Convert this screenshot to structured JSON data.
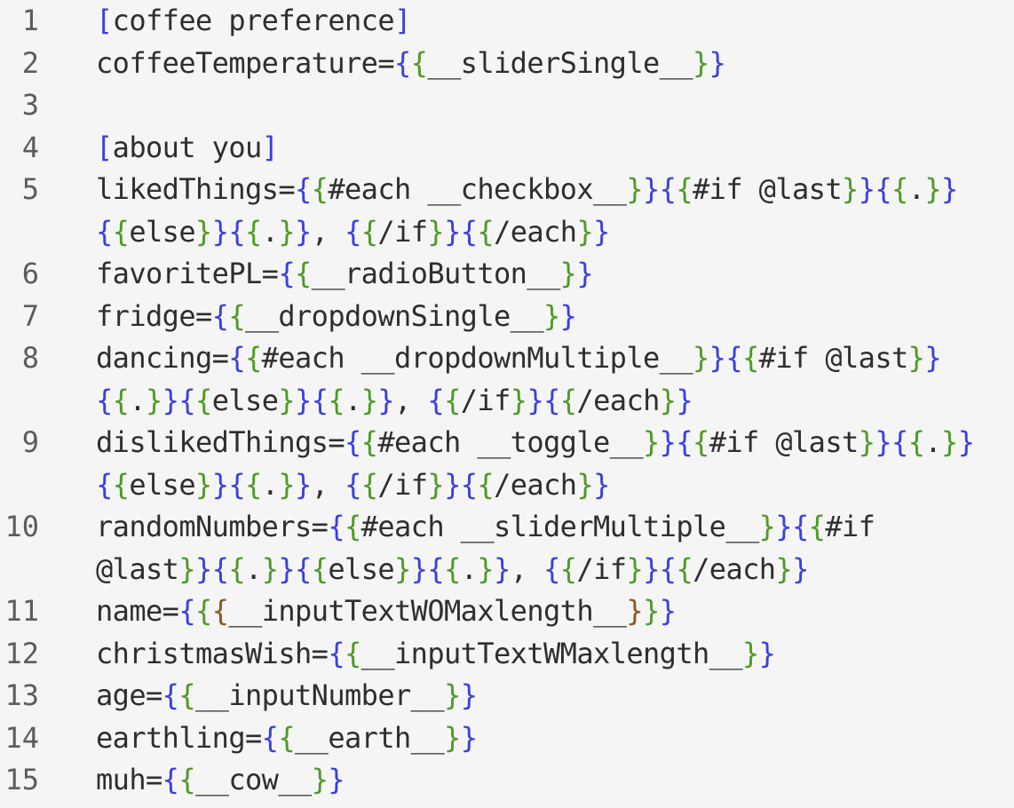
{
  "editor": {
    "line_numbers": [
      "1",
      "2",
      "3",
      "4",
      "5",
      "6",
      "7",
      "8",
      "9",
      "10",
      "11",
      "12",
      "13",
      "14",
      "15"
    ],
    "lines": [
      {
        "row": 0,
        "tokens": [
          [
            "sq",
            "["
          ],
          [
            "t",
            "coffee preference"
          ],
          [
            "sq",
            "]"
          ]
        ]
      },
      {
        "row": 1,
        "tokens": [
          [
            "t",
            "coffeeTemperature="
          ],
          [
            "b1",
            "{"
          ],
          [
            "b2",
            "{"
          ],
          [
            "t",
            "__sliderSingle__"
          ],
          [
            "b2",
            "}"
          ],
          [
            "b1",
            "}"
          ]
        ]
      },
      {
        "row": 2,
        "tokens": []
      },
      {
        "row": 3,
        "tokens": [
          [
            "sq",
            "["
          ],
          [
            "t",
            "about you"
          ],
          [
            "sq",
            "]"
          ]
        ]
      },
      {
        "row": 4,
        "tokens": [
          [
            "t",
            "likedThings="
          ],
          [
            "b1",
            "{"
          ],
          [
            "b2",
            "{"
          ],
          [
            "t",
            "#each __checkbox__"
          ],
          [
            "b2",
            "}"
          ],
          [
            "b1",
            "}"
          ],
          [
            "b1",
            "{"
          ],
          [
            "b2",
            "{"
          ],
          [
            "t",
            "#if @last"
          ],
          [
            "b2",
            "}"
          ],
          [
            "b1",
            "}"
          ],
          [
            "b1",
            "{"
          ],
          [
            "b2",
            "{"
          ],
          [
            "t",
            "."
          ],
          [
            "b2",
            "}"
          ],
          [
            "b1",
            "}"
          ]
        ]
      },
      {
        "row": 5,
        "tokens": [
          [
            "b1",
            "{"
          ],
          [
            "b2",
            "{"
          ],
          [
            "t",
            "else"
          ],
          [
            "b2",
            "}"
          ],
          [
            "b1",
            "}"
          ],
          [
            "b1",
            "{"
          ],
          [
            "b2",
            "{"
          ],
          [
            "t",
            "."
          ],
          [
            "b2",
            "}"
          ],
          [
            "b1",
            "}"
          ],
          [
            "t",
            ", "
          ],
          [
            "b1",
            "{"
          ],
          [
            "b2",
            "{"
          ],
          [
            "t",
            "/if"
          ],
          [
            "b2",
            "}"
          ],
          [
            "b1",
            "}"
          ],
          [
            "b1",
            "{"
          ],
          [
            "b2",
            "{"
          ],
          [
            "t",
            "/each"
          ],
          [
            "b2",
            "}"
          ],
          [
            "b1",
            "}"
          ]
        ]
      },
      {
        "row": 6,
        "tokens": [
          [
            "t",
            "favoritePL="
          ],
          [
            "b1",
            "{"
          ],
          [
            "b2",
            "{"
          ],
          [
            "t",
            "__radioButton__"
          ],
          [
            "b2",
            "}"
          ],
          [
            "b1",
            "}"
          ]
        ]
      },
      {
        "row": 7,
        "tokens": [
          [
            "t",
            "fridge="
          ],
          [
            "b1",
            "{"
          ],
          [
            "b2",
            "{"
          ],
          [
            "t",
            "__dropdownSingle__"
          ],
          [
            "b2",
            "}"
          ],
          [
            "b1",
            "}"
          ]
        ]
      },
      {
        "row": 8,
        "tokens": [
          [
            "t",
            "dancing="
          ],
          [
            "b1",
            "{"
          ],
          [
            "b2",
            "{"
          ],
          [
            "t",
            "#each __dropdownMultiple__"
          ],
          [
            "b2",
            "}"
          ],
          [
            "b1",
            "}"
          ],
          [
            "b1",
            "{"
          ],
          [
            "b2",
            "{"
          ],
          [
            "t",
            "#if @last"
          ],
          [
            "b2",
            "}"
          ],
          [
            "b1",
            "}"
          ]
        ]
      },
      {
        "row": 9,
        "tokens": [
          [
            "b1",
            "{"
          ],
          [
            "b2",
            "{"
          ],
          [
            "t",
            "."
          ],
          [
            "b2",
            "}"
          ],
          [
            "b1",
            "}"
          ],
          [
            "b1",
            "{"
          ],
          [
            "b2",
            "{"
          ],
          [
            "t",
            "else"
          ],
          [
            "b2",
            "}"
          ],
          [
            "b1",
            "}"
          ],
          [
            "b1",
            "{"
          ],
          [
            "b2",
            "{"
          ],
          [
            "t",
            "."
          ],
          [
            "b2",
            "}"
          ],
          [
            "b1",
            "}"
          ],
          [
            "t",
            ", "
          ],
          [
            "b1",
            "{"
          ],
          [
            "b2",
            "{"
          ],
          [
            "t",
            "/if"
          ],
          [
            "b2",
            "}"
          ],
          [
            "b1",
            "}"
          ],
          [
            "b1",
            "{"
          ],
          [
            "b2",
            "{"
          ],
          [
            "t",
            "/each"
          ],
          [
            "b2",
            "}"
          ],
          [
            "b1",
            "}"
          ]
        ]
      },
      {
        "row": 10,
        "tokens": [
          [
            "t",
            "dislikedThings="
          ],
          [
            "b1",
            "{"
          ],
          [
            "b2",
            "{"
          ],
          [
            "t",
            "#each __toggle__"
          ],
          [
            "b2",
            "}"
          ],
          [
            "b1",
            "}"
          ],
          [
            "b1",
            "{"
          ],
          [
            "b2",
            "{"
          ],
          [
            "t",
            "#if @last"
          ],
          [
            "b2",
            "}"
          ],
          [
            "b1",
            "}"
          ],
          [
            "b1",
            "{"
          ],
          [
            "b2",
            "{"
          ],
          [
            "t",
            "."
          ],
          [
            "b2",
            "}"
          ],
          [
            "b1",
            "}"
          ]
        ]
      },
      {
        "row": 11,
        "tokens": [
          [
            "b1",
            "{"
          ],
          [
            "b2",
            "{"
          ],
          [
            "t",
            "else"
          ],
          [
            "b2",
            "}"
          ],
          [
            "b1",
            "}"
          ],
          [
            "b1",
            "{"
          ],
          [
            "b2",
            "{"
          ],
          [
            "t",
            "."
          ],
          [
            "b2",
            "}"
          ],
          [
            "b1",
            "}"
          ],
          [
            "t",
            ", "
          ],
          [
            "b1",
            "{"
          ],
          [
            "b2",
            "{"
          ],
          [
            "t",
            "/if"
          ],
          [
            "b2",
            "}"
          ],
          [
            "b1",
            "}"
          ],
          [
            "b1",
            "{"
          ],
          [
            "b2",
            "{"
          ],
          [
            "t",
            "/each"
          ],
          [
            "b2",
            "}"
          ],
          [
            "b1",
            "}"
          ]
        ]
      },
      {
        "row": 12,
        "tokens": [
          [
            "t",
            "randomNumbers="
          ],
          [
            "b1",
            "{"
          ],
          [
            "b2",
            "{"
          ],
          [
            "t",
            "#each __sliderMultiple__"
          ],
          [
            "b2",
            "}"
          ],
          [
            "b1",
            "}"
          ],
          [
            "b1",
            "{"
          ],
          [
            "b2",
            "{"
          ],
          [
            "t",
            "#if"
          ]
        ]
      },
      {
        "row": 13,
        "tokens": [
          [
            "t",
            "@last"
          ],
          [
            "b2",
            "}"
          ],
          [
            "b1",
            "}"
          ],
          [
            "b1",
            "{"
          ],
          [
            "b2",
            "{"
          ],
          [
            "t",
            "."
          ],
          [
            "b2",
            "}"
          ],
          [
            "b1",
            "}"
          ],
          [
            "b1",
            "{"
          ],
          [
            "b2",
            "{"
          ],
          [
            "t",
            "else"
          ],
          [
            "b2",
            "}"
          ],
          [
            "b1",
            "}"
          ],
          [
            "b1",
            "{"
          ],
          [
            "b2",
            "{"
          ],
          [
            "t",
            "."
          ],
          [
            "b2",
            "}"
          ],
          [
            "b1",
            "}"
          ],
          [
            "t",
            ", "
          ],
          [
            "b1",
            "{"
          ],
          [
            "b2",
            "{"
          ],
          [
            "t",
            "/if"
          ],
          [
            "b2",
            "}"
          ],
          [
            "b1",
            "}"
          ],
          [
            "b1",
            "{"
          ],
          [
            "b2",
            "{"
          ],
          [
            "t",
            "/each"
          ],
          [
            "b2",
            "}"
          ],
          [
            "b1",
            "}"
          ]
        ]
      },
      {
        "row": 14,
        "tokens": [
          [
            "t",
            "name="
          ],
          [
            "b1",
            "{"
          ],
          [
            "b2",
            "{"
          ],
          [
            "b3",
            "{"
          ],
          [
            "t",
            "__inputTextWOMaxlength__"
          ],
          [
            "b3",
            "}"
          ],
          [
            "b2",
            "}"
          ],
          [
            "b1",
            "}"
          ]
        ]
      },
      {
        "row": 15,
        "tokens": [
          [
            "t",
            "christmasWish="
          ],
          [
            "b1",
            "{"
          ],
          [
            "b2",
            "{"
          ],
          [
            "t",
            "__inputTextWMaxlength__"
          ],
          [
            "b2",
            "}"
          ],
          [
            "b1",
            "}"
          ]
        ]
      },
      {
        "row": 16,
        "tokens": [
          [
            "t",
            "age="
          ],
          [
            "b1",
            "{"
          ],
          [
            "b2",
            "{"
          ],
          [
            "t",
            "__inputNumber__"
          ],
          [
            "b2",
            "}"
          ],
          [
            "b1",
            "}"
          ]
        ]
      },
      {
        "row": 17,
        "tokens": [
          [
            "t",
            "earthling="
          ],
          [
            "b1",
            "{"
          ],
          [
            "b2",
            "{"
          ],
          [
            "t",
            "__earth__"
          ],
          [
            "b2",
            "}"
          ],
          [
            "b1",
            "}"
          ]
        ]
      },
      {
        "row": 18,
        "tokens": [
          [
            "t",
            "muh="
          ],
          [
            "b1",
            "{"
          ],
          [
            "b2",
            "{"
          ],
          [
            "t",
            "__cow__"
          ],
          [
            "b2",
            "}"
          ],
          [
            "b1",
            "}"
          ]
        ]
      }
    ],
    "gutter_rows": [
      0,
      1,
      2,
      3,
      4,
      6,
      7,
      8,
      10,
      12,
      14,
      15,
      16,
      17,
      18
    ],
    "colors": {
      "background": "#f5f5f5",
      "text": "#2e2e2e",
      "line_number": "#5c5c5c",
      "brace_outer": "#3b3fe0",
      "brace_inner": "#4e9a26",
      "brace_third": "#8a5a1a"
    }
  }
}
